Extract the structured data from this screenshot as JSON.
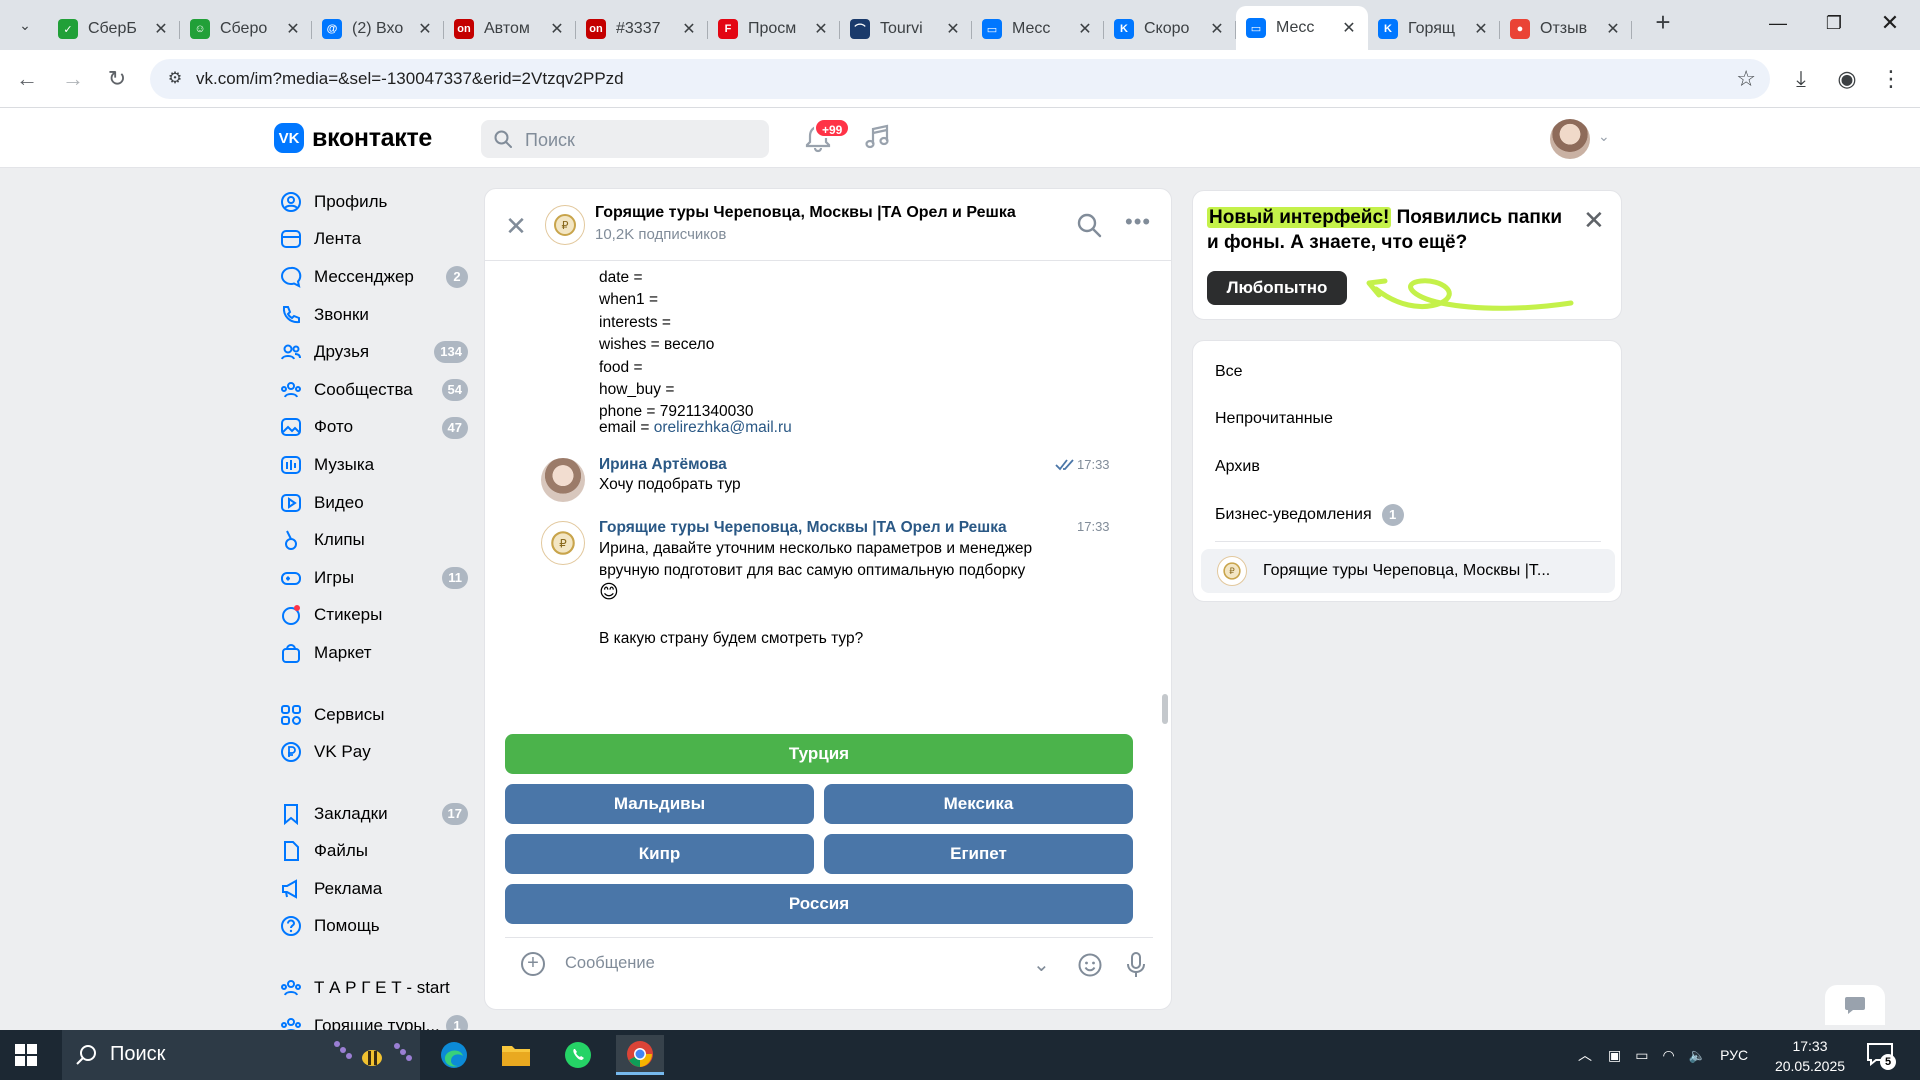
{
  "browser": {
    "tabs": [
      {
        "title": "СберБ",
        "fav_color": "#21a038",
        "fav_glyph": "✓"
      },
      {
        "title": "Сберо",
        "fav_color": "#21a038",
        "fav_glyph": "☺"
      },
      {
        "title": "(2) Вхо",
        "fav_color": "#0077ff",
        "fav_glyph": "@"
      },
      {
        "title": "Автом",
        "fav_color": "#c40000",
        "fav_glyph": "on"
      },
      {
        "title": "#3337",
        "fav_color": "#c40000",
        "fav_glyph": "on"
      },
      {
        "title": "Просм",
        "fav_color": "#e30613",
        "fav_glyph": "F"
      },
      {
        "title": "Tourvi",
        "fav_color": "#1a3a6b",
        "fav_glyph": "⌒"
      },
      {
        "title": "Месс",
        "fav_color": "#0077ff",
        "fav_glyph": "▭"
      },
      {
        "title": "Скоро",
        "fav_color": "#0077ff",
        "fav_glyph": "K"
      },
      {
        "title": "Месс",
        "fav_color": "#0077ff",
        "fav_glyph": "▭",
        "active": true
      },
      {
        "title": "Горящ",
        "fav_color": "#0077ff",
        "fav_glyph": "K"
      },
      {
        "title": "Отзыв",
        "fav_color": "#ea4335",
        "fav_glyph": "●"
      }
    ],
    "url": "vk.com/im?media=&sel=-130047337&erid=2Vtzqv2PPzd"
  },
  "vk_header": {
    "logo_text": "вконтакте",
    "search_placeholder": "Поиск",
    "notifications_badge": "+99"
  },
  "left_menu": {
    "items": [
      {
        "label": "Профиль",
        "icon": "user-circle-icon",
        "count": ""
      },
      {
        "label": "Лента",
        "icon": "feed-icon",
        "count": ""
      },
      {
        "label": "Мессенджер",
        "icon": "message-icon",
        "count": "2"
      },
      {
        "label": "Звонки",
        "icon": "phone-icon",
        "count": ""
      },
      {
        "label": "Друзья",
        "icon": "friends-icon",
        "count": "134"
      },
      {
        "label": "Сообщества",
        "icon": "communities-icon",
        "count": "54"
      },
      {
        "label": "Фото",
        "icon": "photo-icon",
        "count": "47"
      },
      {
        "label": "Музыка",
        "icon": "music-icon",
        "count": ""
      },
      {
        "label": "Видео",
        "icon": "video-icon",
        "count": ""
      },
      {
        "label": "Клипы",
        "icon": "clips-icon",
        "count": ""
      },
      {
        "label": "Игры",
        "icon": "games-icon",
        "count": "11"
      },
      {
        "label": "Стикеры",
        "icon": "stickers-icon",
        "count": ""
      },
      {
        "label": "Маркет",
        "icon": "market-icon",
        "count": ""
      }
    ],
    "items2": [
      {
        "label": "Сервисы",
        "icon": "services-icon",
        "count": ""
      },
      {
        "label": "VK Pay",
        "icon": "vkpay-icon",
        "count": ""
      }
    ],
    "items3": [
      {
        "label": "Закладки",
        "icon": "bookmark-icon",
        "count": "17"
      },
      {
        "label": "Файлы",
        "icon": "file-icon",
        "count": ""
      },
      {
        "label": "Реклама",
        "icon": "ads-icon",
        "count": ""
      },
      {
        "label": "Помощь",
        "icon": "help-icon",
        "count": ""
      }
    ],
    "items4": [
      {
        "label": "Т А Р Г Е Т - start",
        "icon": "communities-icon",
        "count": ""
      },
      {
        "label": "Горящие туры...",
        "icon": "communities-icon",
        "count": "1"
      }
    ]
  },
  "chat": {
    "title": "Горящие туры Череповца, Москвы |ТА Орел и Решка",
    "subscribers": "10,2K подписчиков",
    "fields": [
      "date =",
      "when1 =",
      "interests =",
      "wishes = весело",
      "food =",
      "how_buy =",
      "phone = 79211340030"
    ],
    "email_prefix": "email = ",
    "email": "orelirezhka@mail.ru",
    "messages": [
      {
        "author": "Ирина Артёмова",
        "time": "17:33",
        "text": "Хочу подобрать тур"
      },
      {
        "author": "Горящие туры Череповца, Москвы |ТА Орел и Решка",
        "time": "17:33",
        "text1": "Ирина, давайте уточним несколько параметров и менеджер",
        "text2": "вручную подготовит для вас самую оптимальную подборку",
        "emoji": "😊",
        "text3": "В какую страну будем смотреть тур?"
      }
    ],
    "keyboard": [
      "Турция",
      "Мальдивы",
      "Мексика",
      "Кипр",
      "Египет",
      "Россия"
    ],
    "composer_placeholder": "Сообщение"
  },
  "promo": {
    "highlight": "Новый интерфейс!",
    "text": " Появились папки и фоны. А знаете, что ещё?",
    "button": "Любопытно"
  },
  "folders": {
    "items": [
      "Все",
      "Непрочитанные",
      "Архив",
      "Бизнес-уведомления"
    ],
    "business_count": "1",
    "pinned_chat": "Горящие туры Череповца, Москвы |Т..."
  },
  "taskbar": {
    "search_placeholder": "Поиск",
    "lang": "РУС",
    "time": "17:33",
    "date": "20.05.2025",
    "notif_count": "5"
  }
}
